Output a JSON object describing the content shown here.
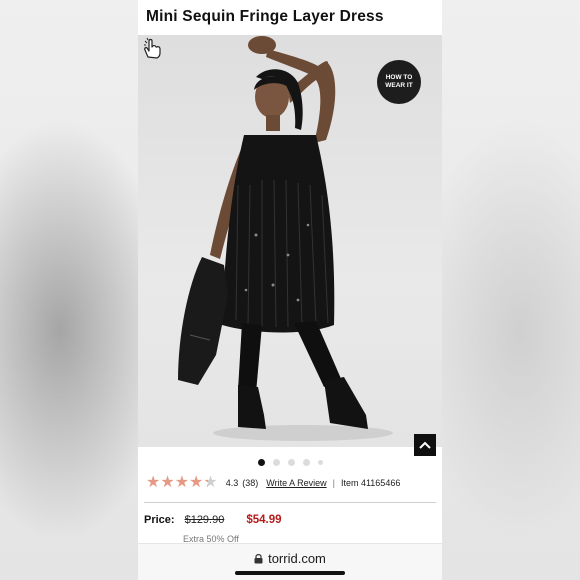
{
  "product": {
    "title": "Mini Sequin Fringe Layer Dress",
    "how_to_wear": {
      "line1": "HOW TO",
      "line2": "WEAR IT"
    },
    "carousel": {
      "total": 5,
      "active": 1
    },
    "rating": {
      "value": "4.3",
      "stars": 4.3,
      "count": "(38)"
    },
    "write_review": "Write A Review",
    "separator": "|",
    "item_number": "Item 41165466",
    "price": {
      "label": "Price:",
      "original": "$129.90",
      "sale": "$54.99",
      "discount_note": "Extra 50% Off"
    }
  },
  "browser": {
    "url": "torrid.com"
  },
  "colors": {
    "sale_price": "#b31b1b",
    "star": "#e59a86",
    "button_dark": "#111111"
  },
  "icons": [
    "how-to-wear-badge",
    "hand-pointer-icon",
    "chevron-up-icon",
    "lock-icon",
    "star-icon"
  ]
}
